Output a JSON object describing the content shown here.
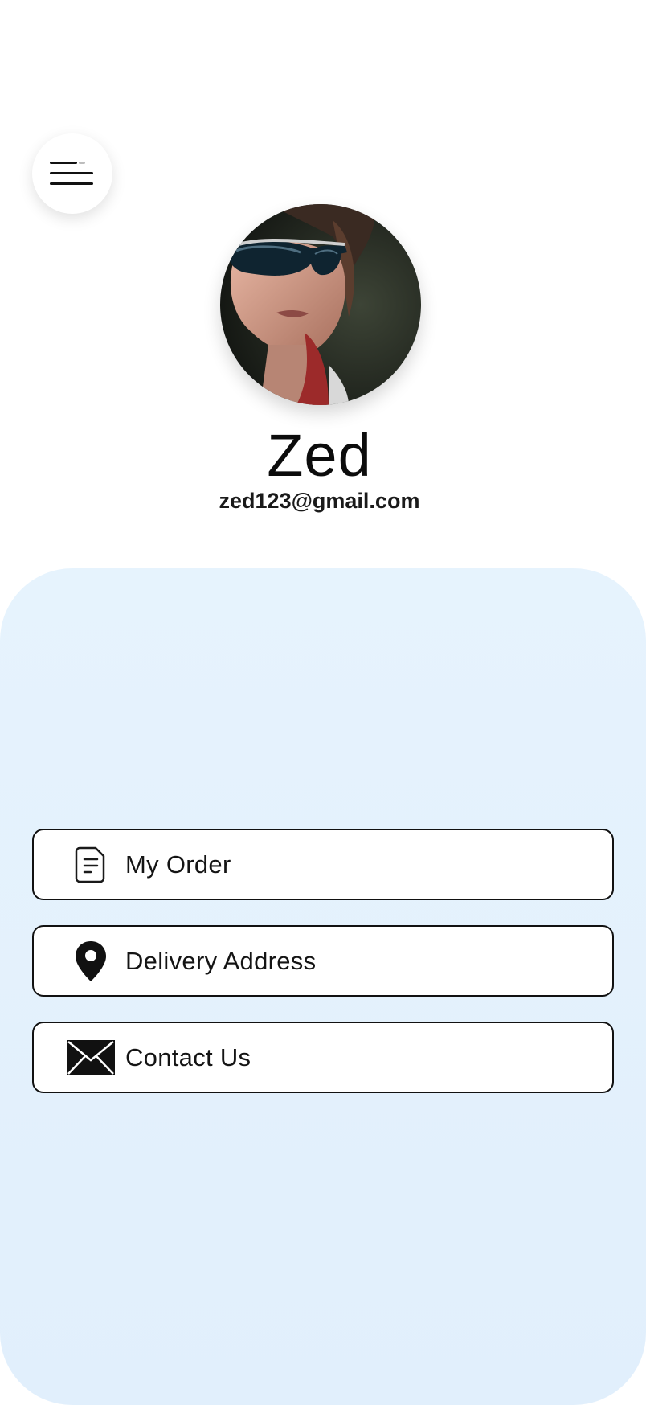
{
  "header": {
    "menu_icon": "hamburger-menu-icon"
  },
  "profile": {
    "name": "Zed",
    "email": "zed123@gmail.com",
    "avatar": "profile-photo"
  },
  "menu": {
    "items": [
      {
        "label": "My Order",
        "icon": "document-icon"
      },
      {
        "label": "Delivery Address",
        "icon": "location-pin-icon"
      },
      {
        "label": "Contact Us",
        "icon": "envelope-icon"
      }
    ]
  },
  "colors": {
    "panel_background": "#e3f1fc",
    "item_border": "#111111",
    "text": "#111111"
  }
}
